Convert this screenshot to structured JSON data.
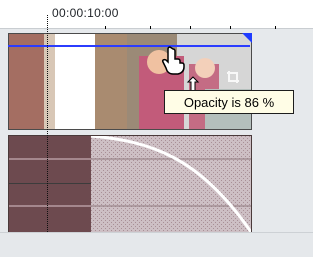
{
  "ruler": {
    "timecode": "00:00:10:00"
  },
  "tooltip": {
    "text": "Opacity is 86 %"
  },
  "video_clip": {
    "opacity_percent": 86
  },
  "colors": {
    "opacity_line": "#2b3cff",
    "audio_selected": "#6d4a4f",
    "audio_rest": "#cdbfc4",
    "tooltip_bg": "#fffde6"
  },
  "icons": [
    "hand-cursor-icon",
    "resize-vertical-icon",
    "crop-icon",
    "fade-corner-icon"
  ]
}
